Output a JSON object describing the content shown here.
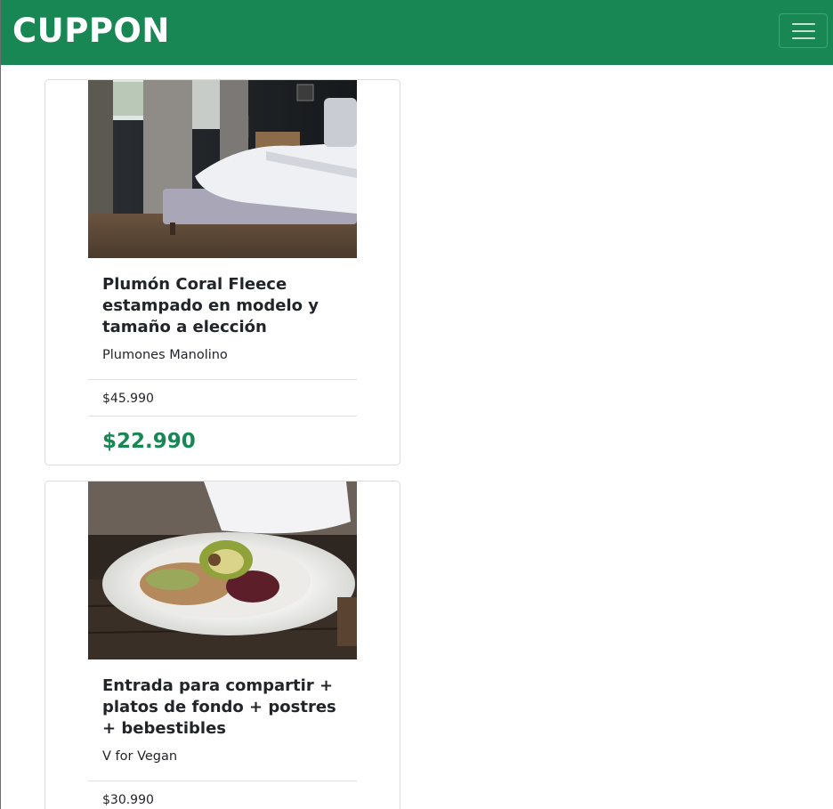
{
  "header": {
    "brand": "CUPPON",
    "menu_icon": "hamburger-menu-icon",
    "background_color": "#198754"
  },
  "cards": [
    {
      "image": "bed-photo",
      "title": "Plumón Coral Fleece estampado en modelo y tamaño a elección",
      "merchant": "Plumones Manolino",
      "original_price": "$45.990",
      "discount_price": "$22.990"
    },
    {
      "image": "vegan-dish-photo",
      "title": "Entrada para compartir + platos de fondo + postres + bebestibles",
      "merchant": "V for Vegan",
      "original_price": "$30.990"
    }
  ],
  "colors": {
    "accent": "#198754",
    "text": "#212529",
    "border": "#dcdcdc"
  }
}
